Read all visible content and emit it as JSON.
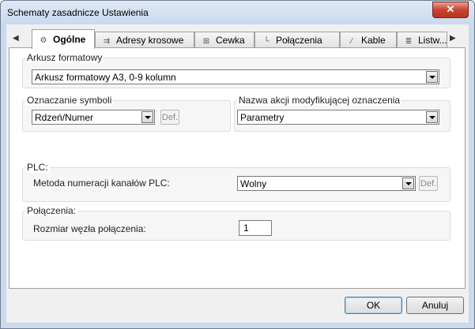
{
  "window": {
    "title": "Schematy zasadnicze Ustawienia",
    "close_glyph": "✕"
  },
  "tabs": [
    {
      "label": "Ogólne",
      "icon": "general-settings-icon"
    },
    {
      "label": "Adresy krosowe",
      "icon": "cross-address-icon"
    },
    {
      "label": "Cewka",
      "icon": "coil-icon"
    },
    {
      "label": "Połączenia",
      "icon": "connection-icon"
    },
    {
      "label": "Kable",
      "icon": "cable-icon"
    },
    {
      "label": "Listw...",
      "icon": "terminal-strip-icon"
    }
  ],
  "tab_arrows": {
    "left": "◀",
    "right": "▶"
  },
  "arkusz": {
    "label": "Arkusz formatowy",
    "value": "Arkusz formatowy A3, 0-9 kolumn"
  },
  "oznaczanie": {
    "label": "Oznaczanie symboli",
    "value": "Rdzeń/Numer",
    "def": "Def."
  },
  "nazwa_akcji": {
    "label": "Nazwa akcji modyfikującej oznaczenia",
    "value": "Parametry"
  },
  "plc": {
    "label": "PLC:",
    "field_label": "Metoda numeracji kanałów PLC:",
    "value": "Wolny",
    "def": "Def."
  },
  "polaczenia": {
    "label": "Połączenia:",
    "field_label": "Rozmiar węzła połączenia:",
    "value": "1"
  },
  "buttons": {
    "ok": "OK",
    "cancel": "Anuluj"
  }
}
